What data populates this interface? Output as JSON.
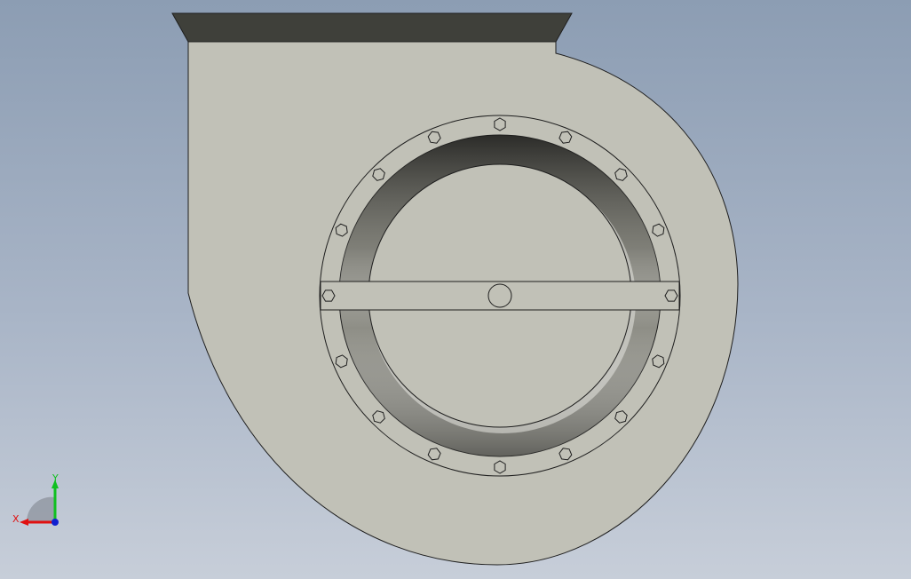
{
  "viewport": {
    "background_top": "#8c9db3",
    "background_bottom": "#c7ced9"
  },
  "model": {
    "body_color": "#c1c1b7",
    "flange_top_color": "#3f403a",
    "outline_color": "#1e1e1e",
    "bolt_count": 16
  },
  "triad": {
    "x_label": "X",
    "y_label": "Y",
    "x_color": "#e01010",
    "y_color": "#10c020",
    "z_color": "#1020d0",
    "icon": "axis-triad-icon"
  }
}
